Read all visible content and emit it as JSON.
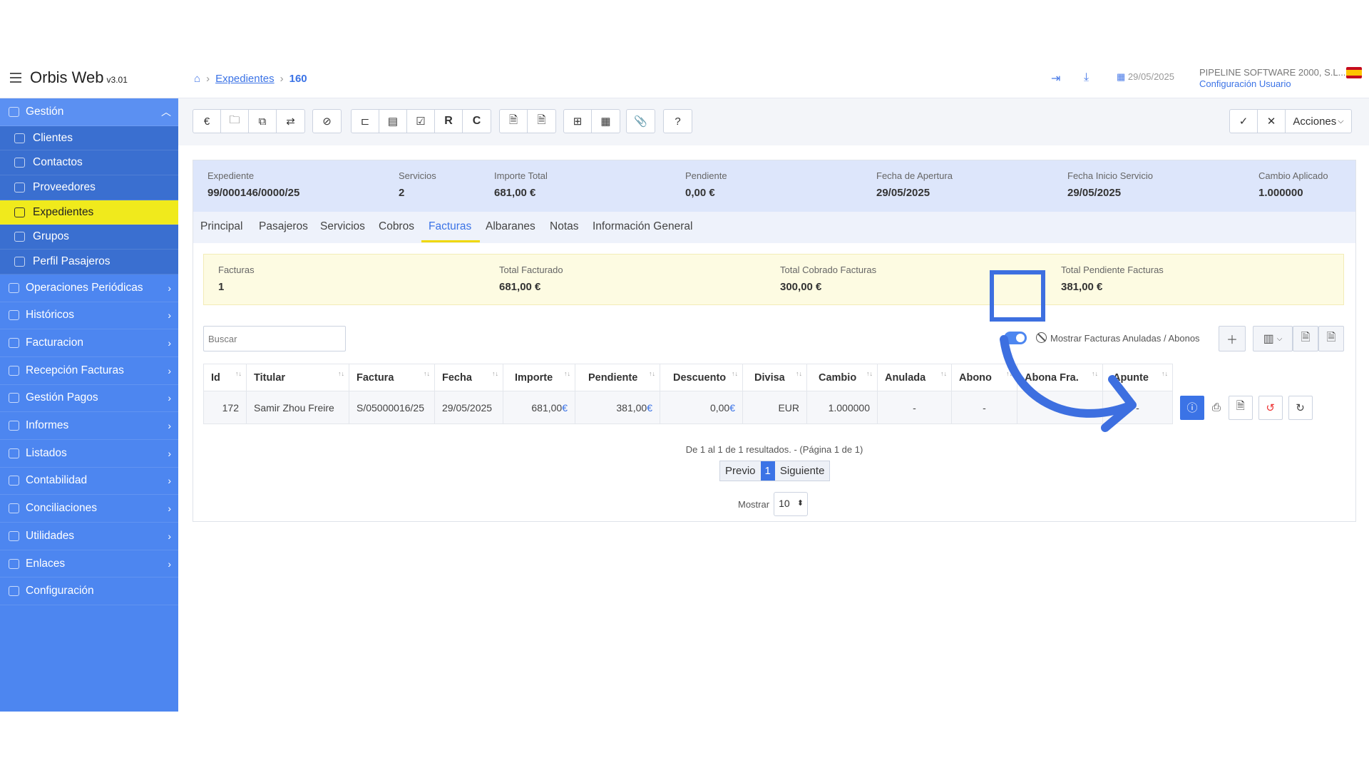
{
  "header": {
    "brand": "Orbis Web",
    "version": "v3.01",
    "breadcrumb": {
      "link": "Expedientes",
      "current": "160"
    },
    "date": "29/05/2025",
    "company": "PIPELINE SOFTWARE 2000, S.L....",
    "config_link": "Configuración Usuario"
  },
  "sidebar": {
    "sections": [
      {
        "label": "Gestión",
        "expanded": true
      },
      {
        "label": "Operaciones Periódicas"
      },
      {
        "label": "Históricos"
      },
      {
        "label": "Facturacion"
      },
      {
        "label": "Recepción Facturas"
      },
      {
        "label": "Gestión Pagos"
      },
      {
        "label": "Informes"
      },
      {
        "label": "Listados"
      },
      {
        "label": "Contabilidad"
      },
      {
        "label": "Conciliaciones"
      },
      {
        "label": "Utilidades"
      },
      {
        "label": "Enlaces"
      },
      {
        "label": "Configuración"
      }
    ],
    "sub": [
      {
        "label": "Clientes"
      },
      {
        "label": "Contactos"
      },
      {
        "label": "Proveedores"
      },
      {
        "label": "Expedientes",
        "active": true
      },
      {
        "label": "Grupos"
      },
      {
        "label": "Perfil Pasajeros"
      }
    ]
  },
  "toolbar": {
    "euro": "€",
    "r": "R",
    "c": "C",
    "acciones": "Acciones"
  },
  "summary": {
    "expediente": {
      "label": "Expediente",
      "value": "99/000146/0000/25"
    },
    "servicios": {
      "label": "Servicios",
      "value": "2"
    },
    "importe": {
      "label": "Importe Total",
      "value": "681,00 €"
    },
    "pendiente": {
      "label": "Pendiente",
      "value": "0,00 €"
    },
    "apertura": {
      "label": "Fecha de Apertura",
      "value": "29/05/2025"
    },
    "inicio": {
      "label": "Fecha Inicio Servicio",
      "value": "29/05/2025"
    },
    "cambio": {
      "label": "Cambio Aplicado",
      "value": "1.000000"
    }
  },
  "tabs": [
    "Principal",
    "Pasajeros",
    "Servicios",
    "Cobros",
    "Facturas",
    "Albaranes",
    "Notas",
    "Información General"
  ],
  "active_tab": "Facturas",
  "totals": {
    "facturas": {
      "label": "Facturas",
      "value": "1"
    },
    "facturado": {
      "label": "Total Facturado",
      "value": "681,00 €"
    },
    "cobrado": {
      "label": "Total Cobrado Facturas",
      "value": "300,00 €"
    },
    "pendiente": {
      "label": "Total Pendiente Facturas",
      "value": "381,00 €"
    }
  },
  "search": {
    "placeholder": "Buscar"
  },
  "toggle_label": "Mostrar Facturas Anuladas / Abonos",
  "table": {
    "columns": [
      "Id",
      "Titular",
      "Factura",
      "Fecha",
      "Importe",
      "Pendiente",
      "Descuento",
      "Divisa",
      "Cambio",
      "Anulada",
      "Abono",
      "Abona Fra.",
      "Apunte"
    ],
    "rows": [
      {
        "id": "172",
        "titular": "Samir Zhou Freire",
        "factura": "S/05000016/25",
        "fecha": "29/05/2025",
        "importe": "681,00",
        "pendiente": "381,00",
        "descuento": "0,00",
        "divisa": "EUR",
        "cambio": "1.000000",
        "anulada": "-",
        "abono": "-",
        "abona": "",
        "apunte": "-",
        "currency": "€"
      }
    ]
  },
  "pager": {
    "info": "De 1 al 1 de 1 resultados. - (Página 1 de 1)",
    "prev": "Previo",
    "page": "1",
    "next": "Siguiente",
    "show_label": "Mostrar",
    "show_value": "10"
  },
  "accent": "#4d86f0",
  "highlight_color": "#f0ea1c"
}
